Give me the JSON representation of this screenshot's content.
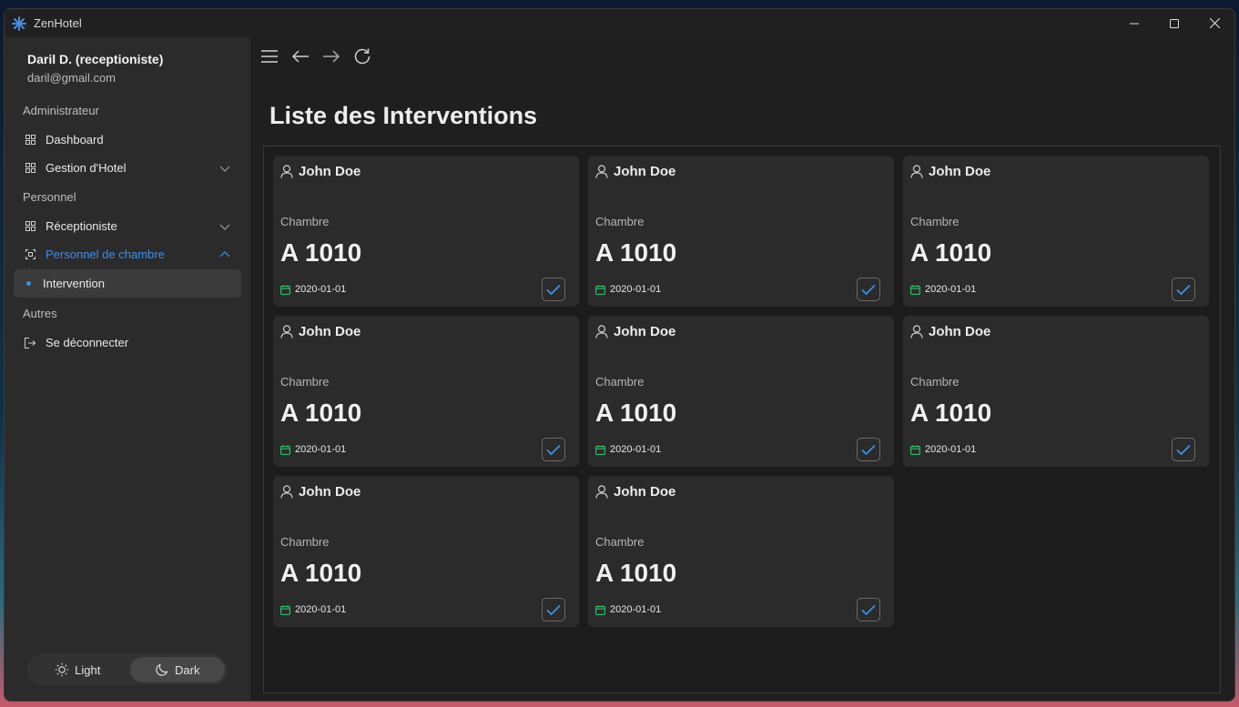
{
  "window": {
    "title": "ZenHotel"
  },
  "user": {
    "name": "Daril D. (receptioniste)",
    "email": "daril@gmail.com"
  },
  "sidebar": {
    "sections": [
      "Administrateur",
      "Personnel",
      "Autres"
    ],
    "items": [
      {
        "label": "Dashboard",
        "icon": "grid-icon"
      },
      {
        "label": "Gestion d'Hotel",
        "icon": "grid-icon"
      },
      {
        "label": "Réceptioniste",
        "icon": "grid-icon"
      },
      {
        "label": "Personnel de chambre",
        "icon": "scan-icon"
      },
      {
        "label": "Intervention",
        "icon": "dot"
      },
      {
        "label": "Se déconnecter",
        "icon": "logout-icon"
      }
    ],
    "accent": "#3f8fe8"
  },
  "theme": {
    "light_label": "Light",
    "dark_label": "Dark",
    "selected": "Dark"
  },
  "main": {
    "title": "Liste des Interventions"
  },
  "cards": [
    {
      "name": "John Doe",
      "sub": "Chambre",
      "room": "A 1010",
      "date": "2020-01-01",
      "checked": true
    },
    {
      "name": "John Doe",
      "sub": "Chambre",
      "room": "A 1010",
      "date": "2020-01-01",
      "checked": true
    },
    {
      "name": "John Doe",
      "sub": "Chambre",
      "room": "A 1010",
      "date": "2020-01-01",
      "checked": true
    },
    {
      "name": "John Doe",
      "sub": "Chambre",
      "room": "A 1010",
      "date": "2020-01-01",
      "checked": true
    },
    {
      "name": "John Doe",
      "sub": "Chambre",
      "room": "A 1010",
      "date": "2020-01-01",
      "checked": true
    },
    {
      "name": "John Doe",
      "sub": "Chambre",
      "room": "A 1010",
      "date": "2020-01-01",
      "checked": true
    },
    {
      "name": "John Doe",
      "sub": "Chambre",
      "room": "A 1010",
      "date": "2020-01-01",
      "checked": true
    },
    {
      "name": "John Doe",
      "sub": "Chambre",
      "room": "A 1010",
      "date": "2020-01-01",
      "checked": true
    }
  ],
  "colors": {
    "date_icon": "#2ec26a",
    "check": "#3f8fe8"
  }
}
